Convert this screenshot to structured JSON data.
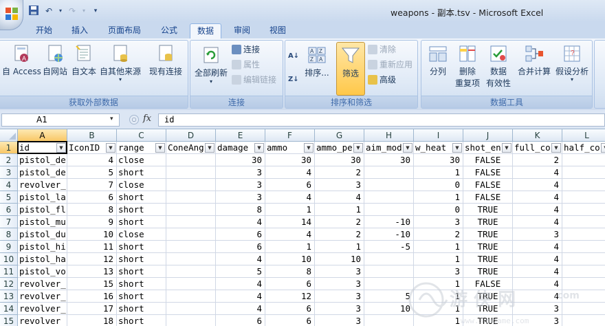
{
  "window": {
    "title": "weapons - 副本.tsv - Microsoft Excel"
  },
  "quick_access": {
    "save_icon": "save-icon",
    "undo_icon": "undo-icon",
    "redo_icon": "redo-icon",
    "customize_icon": "customize-icon"
  },
  "tabs": [
    {
      "label": "开始"
    },
    {
      "label": "插入"
    },
    {
      "label": "页面布局"
    },
    {
      "label": "公式"
    },
    {
      "label": "数据",
      "active": true
    },
    {
      "label": "审阅"
    },
    {
      "label": "视图"
    }
  ],
  "ribbon": {
    "get_external": {
      "label": "获取外部数据",
      "access": "自 Access",
      "web": "自网站",
      "text": "自文本",
      "other": "自其他来源",
      "existing": "现有连接"
    },
    "connections": {
      "label": "连接",
      "refresh_all": "全部刷新",
      "connections": "连接",
      "properties": "属性",
      "edit_links": "编辑链接"
    },
    "sort_filter": {
      "label": "排序和筛选",
      "sort": "排序...",
      "filter": "筛选",
      "clear": "清除",
      "reapply": "重新应用",
      "advanced": "高级"
    },
    "data_tools": {
      "label": "数据工具",
      "text_to_columns": "分列",
      "remove_dup_1": "删除",
      "remove_dup_2": "重复项",
      "validation_1": "数据",
      "validation_2": "有效性",
      "consolidate": "合并计算",
      "what_if": "假设分析"
    }
  },
  "formula_bar": {
    "name_box": "A1",
    "fx": "fx",
    "content": "id"
  },
  "columns": [
    "A",
    "B",
    "C",
    "D",
    "E",
    "F",
    "G",
    "H",
    "I",
    "J",
    "K",
    "L"
  ],
  "headers": [
    "id",
    "IconID",
    "range",
    "ConeAng",
    "damage",
    "ammo",
    "ammo_pe",
    "aim_mod",
    "w_heat",
    "shot_en",
    "full_co",
    "half_co"
  ],
  "rows": [
    {
      "n": "1"
    },
    {
      "n": "2",
      "c": [
        "pistol_de",
        "4",
        "close",
        "",
        "30",
        "30",
        "30",
        "30",
        "30",
        "FALSE",
        "2",
        ""
      ]
    },
    {
      "n": "3",
      "c": [
        "pistol_de",
        "5",
        "short",
        "",
        "3",
        "4",
        "2",
        "",
        "1",
        "FALSE",
        "4",
        ""
      ]
    },
    {
      "n": "4",
      "c": [
        "revolver_",
        "7",
        "close",
        "",
        "3",
        "6",
        "3",
        "",
        "0",
        "FALSE",
        "4",
        ""
      ]
    },
    {
      "n": "5",
      "c": [
        "pistol_la",
        "6",
        "short",
        "",
        "3",
        "4",
        "4",
        "",
        "1",
        "FALSE",
        "4",
        ""
      ]
    },
    {
      "n": "6",
      "c": [
        "pistol_fl",
        "8",
        "short",
        "",
        "8",
        "1",
        "1",
        "",
        "0",
        "TRUE",
        "4",
        ""
      ]
    },
    {
      "n": "7",
      "c": [
        "pistol_mu",
        "9",
        "short",
        "",
        "4",
        "14",
        "2",
        "-10",
        "3",
        "TRUE",
        "4",
        ""
      ]
    },
    {
      "n": "8",
      "c": [
        "pistol_du",
        "10",
        "close",
        "",
        "6",
        "4",
        "2",
        "-10",
        "2",
        "TRUE",
        "3",
        ""
      ]
    },
    {
      "n": "9",
      "c": [
        "pistol_hi",
        "11",
        "short",
        "",
        "6",
        "1",
        "1",
        "-5",
        "1",
        "TRUE",
        "4",
        ""
      ]
    },
    {
      "n": "10",
      "c": [
        "pistol_ha",
        "12",
        "short",
        "",
        "4",
        "10",
        "10",
        "",
        "1",
        "TRUE",
        "4",
        ""
      ]
    },
    {
      "n": "11",
      "c": [
        "pistol_vo",
        "13",
        "short",
        "",
        "5",
        "8",
        "3",
        "",
        "3",
        "TRUE",
        "4",
        ""
      ]
    },
    {
      "n": "12",
      "c": [
        "revolver_",
        "15",
        "short",
        "",
        "4",
        "6",
        "3",
        "",
        "1",
        "FALSE",
        "4",
        ""
      ]
    },
    {
      "n": "13",
      "c": [
        "revolver_",
        "16",
        "short",
        "",
        "4",
        "12",
        "3",
        "5",
        "1",
        "TRUE",
        "4",
        ""
      ]
    },
    {
      "n": "14",
      "c": [
        "revolver_",
        "17",
        "short",
        "",
        "4",
        "6",
        "3",
        "10",
        "1",
        "TRUE",
        "3",
        ""
      ]
    },
    {
      "n": "15",
      "c": [
        "revolver",
        "18",
        "short",
        "",
        "6",
        "6",
        "3",
        "",
        "1",
        "TRUE",
        "3",
        ""
      ]
    }
  ],
  "watermark": {
    "text": "www.3dmgame.com"
  }
}
